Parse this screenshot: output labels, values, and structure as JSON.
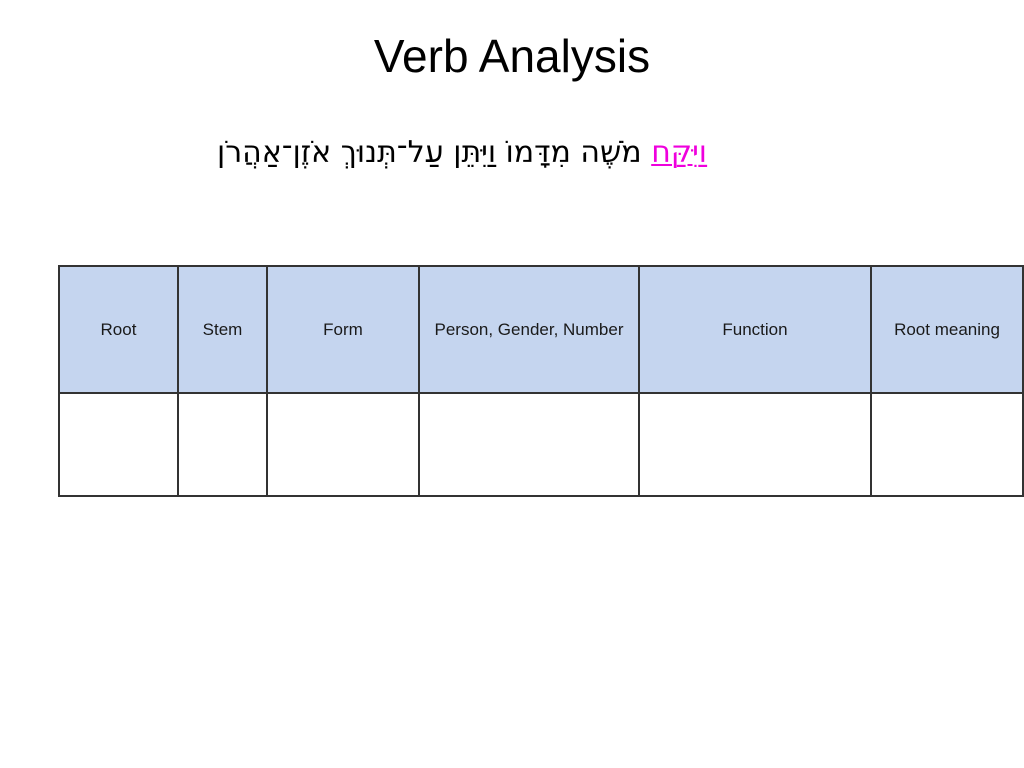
{
  "slide": {
    "title": "Verb Analysis",
    "verse": {
      "highlight_word": "וַיִּקַּח",
      "rest": " מֹשֶׁה מִדָּמוֹ וַיִּתֵּן עַל־תְּנוּךְ אֹזֶן־אַהֲרֹן",
      "highlight_color": "#ef00dd",
      "text_color": "#000000"
    },
    "table": {
      "header_background": "#c5d5ef",
      "border_color": "#333333",
      "headers": [
        "Root",
        "Stem",
        "Form",
        "Person, Gender, Number",
        "Function",
        "Root meaning"
      ],
      "rows": [
        [
          "",
          "",
          "",
          "",
          "",
          ""
        ]
      ]
    }
  }
}
